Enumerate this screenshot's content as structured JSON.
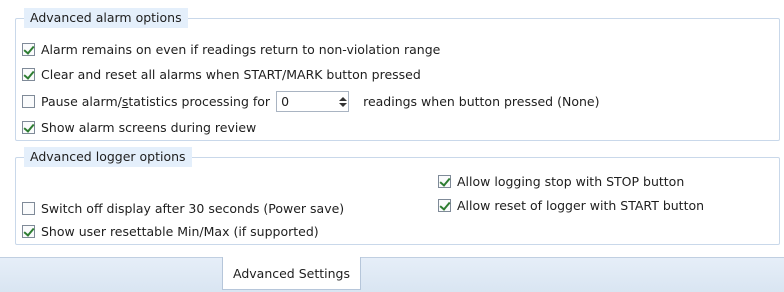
{
  "alarm": {
    "title": "Advanced alarm options",
    "items": [
      {
        "label": "Alarm remains on even if readings return to non-violation range",
        "checked": true
      },
      {
        "label": "Clear and reset all alarms when START/MARK button pressed",
        "checked": true
      },
      {
        "label_pre": "Pause alarm/",
        "label_u": "s",
        "label_post": "tatistics processing for",
        "checked": false,
        "spinner_value": "0",
        "suffix": "readings when button pressed (None)"
      },
      {
        "label": "Show alarm screens during review",
        "checked": true
      }
    ]
  },
  "logger": {
    "title": "Advanced logger options",
    "items": [
      {
        "label": "Allow logging stop with STOP button",
        "checked": true
      },
      {
        "label": "Allow reset of logger with START button",
        "checked": true
      },
      {
        "label": "Switch off display after 30 seconds (Power save)",
        "checked": false
      },
      {
        "label": "Show user resettable Min/Max (if supported)",
        "checked": true
      }
    ]
  },
  "tabs": {
    "active": "Advanced Settings"
  }
}
